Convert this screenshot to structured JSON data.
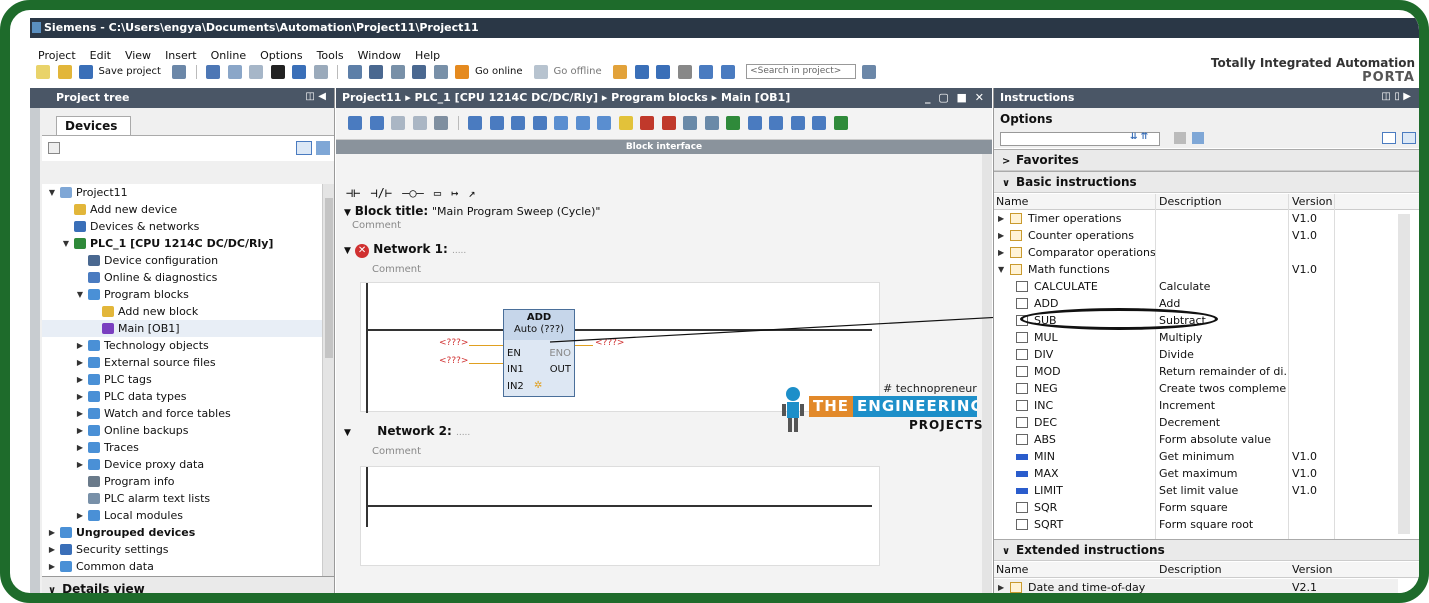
{
  "titlebar": {
    "title": "Siemens - C:\\Users\\engya\\Documents\\Automation\\Project11\\Project11"
  },
  "menu": [
    "Project",
    "Edit",
    "View",
    "Insert",
    "Online",
    "Options",
    "Tools",
    "Window",
    "Help"
  ],
  "brand": {
    "line1": "Totally Integrated Automation",
    "line2": "PORTA"
  },
  "toolbar": {
    "save_label": "Save project",
    "go_online": "Go online",
    "go_offline": "Go offline",
    "search_placeholder": "<Search in project>"
  },
  "project_tree": {
    "header": "Project tree",
    "tab": "Devices",
    "items": [
      {
        "label": "Project11",
        "level": 0,
        "arrow": "▼",
        "icon": "project-icon"
      },
      {
        "label": "Add new device",
        "level": 1,
        "arrow": "",
        "icon": "add-device-icon"
      },
      {
        "label": "Devices & networks",
        "level": 1,
        "arrow": "",
        "icon": "network-icon"
      },
      {
        "label": "PLC_1 [CPU 1214C DC/DC/Rly]",
        "level": 1,
        "arrow": "▼",
        "icon": "plc-icon",
        "bold": true
      },
      {
        "label": "Device configuration",
        "level": 2,
        "arrow": "",
        "icon": "device-config-icon"
      },
      {
        "label": "Online & diagnostics",
        "level": 2,
        "arrow": "",
        "icon": "diagnostics-icon"
      },
      {
        "label": "Program blocks",
        "level": 2,
        "arrow": "▼",
        "icon": "folder-icon"
      },
      {
        "label": "Add new block",
        "level": 3,
        "arrow": "",
        "icon": "add-block-icon"
      },
      {
        "label": "Main [OB1]",
        "level": 3,
        "arrow": "",
        "icon": "ob-icon",
        "selected": true
      },
      {
        "label": "Technology objects",
        "level": 2,
        "arrow": "▶",
        "icon": "folder-icon"
      },
      {
        "label": "External source files",
        "level": 2,
        "arrow": "▶",
        "icon": "folder-icon"
      },
      {
        "label": "PLC tags",
        "level": 2,
        "arrow": "▶",
        "icon": "folder-icon"
      },
      {
        "label": "PLC data types",
        "level": 2,
        "arrow": "▶",
        "icon": "folder-icon"
      },
      {
        "label": "Watch and force tables",
        "level": 2,
        "arrow": "▶",
        "icon": "folder-icon"
      },
      {
        "label": "Online backups",
        "level": 2,
        "arrow": "▶",
        "icon": "folder-icon"
      },
      {
        "label": "Traces",
        "level": 2,
        "arrow": "▶",
        "icon": "folder-icon"
      },
      {
        "label": "Device proxy data",
        "level": 2,
        "arrow": "▶",
        "icon": "folder-icon"
      },
      {
        "label": "Program info",
        "level": 2,
        "arrow": "",
        "icon": "info-icon"
      },
      {
        "label": "PLC alarm text lists",
        "level": 2,
        "arrow": "",
        "icon": "list-icon"
      },
      {
        "label": "Local modules",
        "level": 2,
        "arrow": "▶",
        "icon": "folder-icon"
      },
      {
        "label": "Ungrouped devices",
        "level": 0,
        "arrow": "▶",
        "icon": "folder-icon",
        "bold": true
      },
      {
        "label": "Security settings",
        "level": 0,
        "arrow": "▶",
        "icon": "security-icon"
      },
      {
        "label": "Common data",
        "level": 0,
        "arrow": "▶",
        "icon": "folder-icon"
      }
    ],
    "details": "Details view"
  },
  "editor": {
    "breadcrumb": "Project11 ▸ PLC_1 [CPU 1214C DC/DC/Rly] ▸ Program blocks ▸ Main [OB1]",
    "block_interface": "Block interface",
    "block_title": "Block title:",
    "block_title_value": "\"Main Program Sweep (Cycle)\"",
    "comment": "Comment",
    "network1": "Network 1:",
    "network2": "Network 2:",
    "net_dots": ".....",
    "block": {
      "name": "ADD",
      "type": "Auto (???)",
      "en": "EN",
      "eno": "ENO",
      "in1": "IN1",
      "in2": "IN2",
      "out": "OUT",
      "placeholder": "<???>"
    }
  },
  "watermark": {
    "hashtag": "# technopreneur",
    "the": "THE",
    "engineering": "ENGINEERING",
    "projects": "PROJECTS"
  },
  "instructions": {
    "header": "Instructions",
    "options": "Options",
    "favorites": "Favorites",
    "basic": "Basic instructions",
    "extended": "Extended instructions",
    "col_name": "Name",
    "col_desc": "Description",
    "col_version": "Version",
    "basic_rows": [
      {
        "name": "Timer operations",
        "desc": "",
        "version": "V1.0",
        "arrow": "▶",
        "kind": "folder"
      },
      {
        "name": "Counter operations",
        "desc": "",
        "version": "V1.0",
        "arrow": "▶",
        "kind": "folder"
      },
      {
        "name": "Comparator operations",
        "desc": "",
        "version": "",
        "arrow": "▶",
        "kind": "folder"
      },
      {
        "name": "Math functions",
        "desc": "",
        "version": "V1.0",
        "arrow": "▼",
        "kind": "folder"
      },
      {
        "name": "CALCULATE",
        "desc": "Calculate",
        "version": "",
        "arrow": "",
        "kind": "box"
      },
      {
        "name": "ADD",
        "desc": "Add",
        "version": "",
        "arrow": "",
        "kind": "box"
      },
      {
        "name": "SUB",
        "desc": "Subtract",
        "version": "",
        "arrow": "",
        "kind": "box"
      },
      {
        "name": "MUL",
        "desc": "Multiply",
        "version": "",
        "arrow": "",
        "kind": "box"
      },
      {
        "name": "DIV",
        "desc": "Divide",
        "version": "",
        "arrow": "",
        "kind": "box"
      },
      {
        "name": "MOD",
        "desc": "Return remainder of di...",
        "version": "",
        "arrow": "",
        "kind": "box"
      },
      {
        "name": "NEG",
        "desc": "Create twos complemen",
        "version": "",
        "arrow": "",
        "kind": "box"
      },
      {
        "name": "INC",
        "desc": "Increment",
        "version": "",
        "arrow": "",
        "kind": "box"
      },
      {
        "name": "DEC",
        "desc": "Decrement",
        "version": "",
        "arrow": "",
        "kind": "box"
      },
      {
        "name": "ABS",
        "desc": "Form absolute value",
        "version": "",
        "arrow": "",
        "kind": "box"
      },
      {
        "name": "MIN",
        "desc": "Get minimum",
        "version": "V1.0",
        "arrow": "",
        "kind": "blue"
      },
      {
        "name": "MAX",
        "desc": "Get maximum",
        "version": "V1.0",
        "arrow": "",
        "kind": "blue"
      },
      {
        "name": "LIMIT",
        "desc": "Set limit value",
        "version": "V1.0",
        "arrow": "",
        "kind": "blue"
      },
      {
        "name": "SQR",
        "desc": "Form square",
        "version": "",
        "arrow": "",
        "kind": "box"
      },
      {
        "name": "SQRT",
        "desc": "Form square root",
        "version": "",
        "arrow": "",
        "kind": "box"
      }
    ],
    "extended_rows": [
      {
        "name": "Date and time-of-day",
        "desc": "",
        "version": "V2.1",
        "arrow": "▶",
        "kind": "folder"
      }
    ]
  },
  "colors": {
    "frame": "#1e6b2b",
    "panel_header": "#4a5666",
    "title_bar": "#2a3746",
    "error": "#d03030",
    "watermark_blue": "#1d8fc9",
    "watermark_orange": "#e2892a"
  }
}
